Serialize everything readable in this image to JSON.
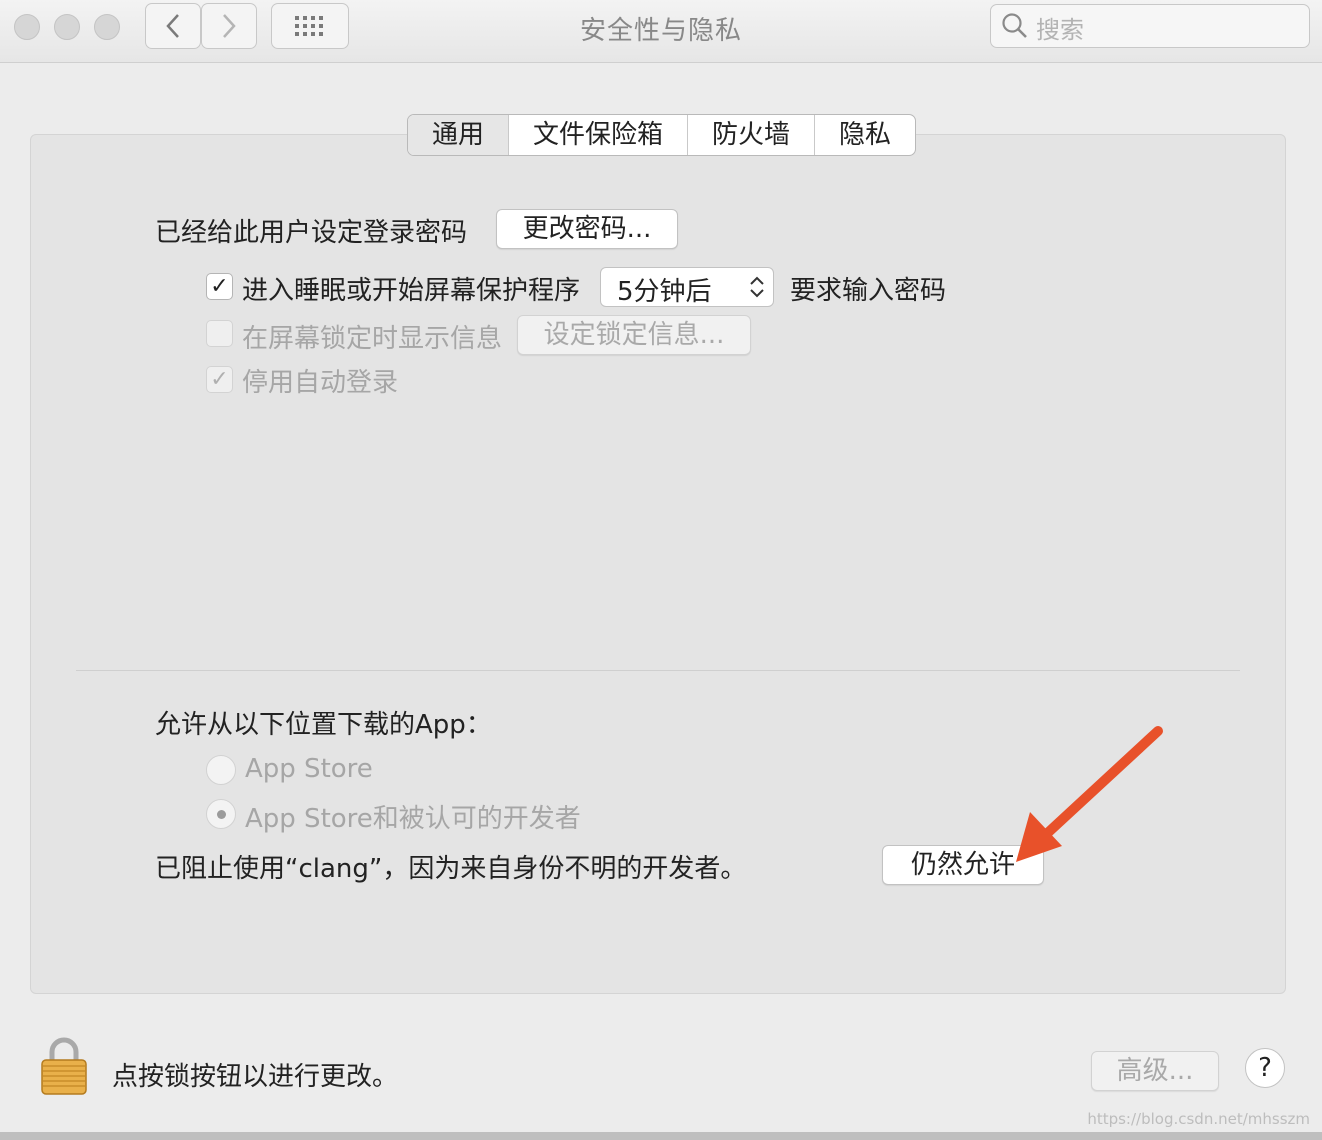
{
  "window": {
    "title": "安全性与隐私",
    "search_placeholder": "搜索"
  },
  "tabs": [
    {
      "label": "通用",
      "active": true
    },
    {
      "label": "文件保险箱",
      "active": false
    },
    {
      "label": "防火墙",
      "active": false
    },
    {
      "label": "隐私",
      "active": false
    }
  ],
  "general": {
    "password_label": "已经给此用户设定登录密码",
    "change_password_button": "更改密码...",
    "require_password": {
      "checked": true,
      "label": "进入睡眠或开始屏幕保护程序",
      "delay_value": "5分钟后",
      "suffix": "要求输入密码"
    },
    "show_message": {
      "checked": false,
      "label": "在屏幕锁定时显示信息",
      "button": "设定锁定信息..."
    },
    "disable_autologin": {
      "checked": true,
      "label": "停用自动登录"
    }
  },
  "downloads": {
    "heading": "允许从以下位置下载的App：",
    "options": [
      {
        "label": "App Store",
        "selected": false
      },
      {
        "label": "App Store和被认可的开发者",
        "selected": true
      }
    ],
    "blocked_message": "已阻止使用“clang”，因为来自身份不明的开发者。",
    "allow_anyway_button": "仍然允许"
  },
  "footer": {
    "lock_message": "点按锁按钮以进行更改。",
    "advanced_button": "高级...",
    "help_button": "?"
  },
  "watermark": "https://blog.csdn.net/mhsszm",
  "colors": {
    "annotation_arrow": "#e8512a"
  }
}
